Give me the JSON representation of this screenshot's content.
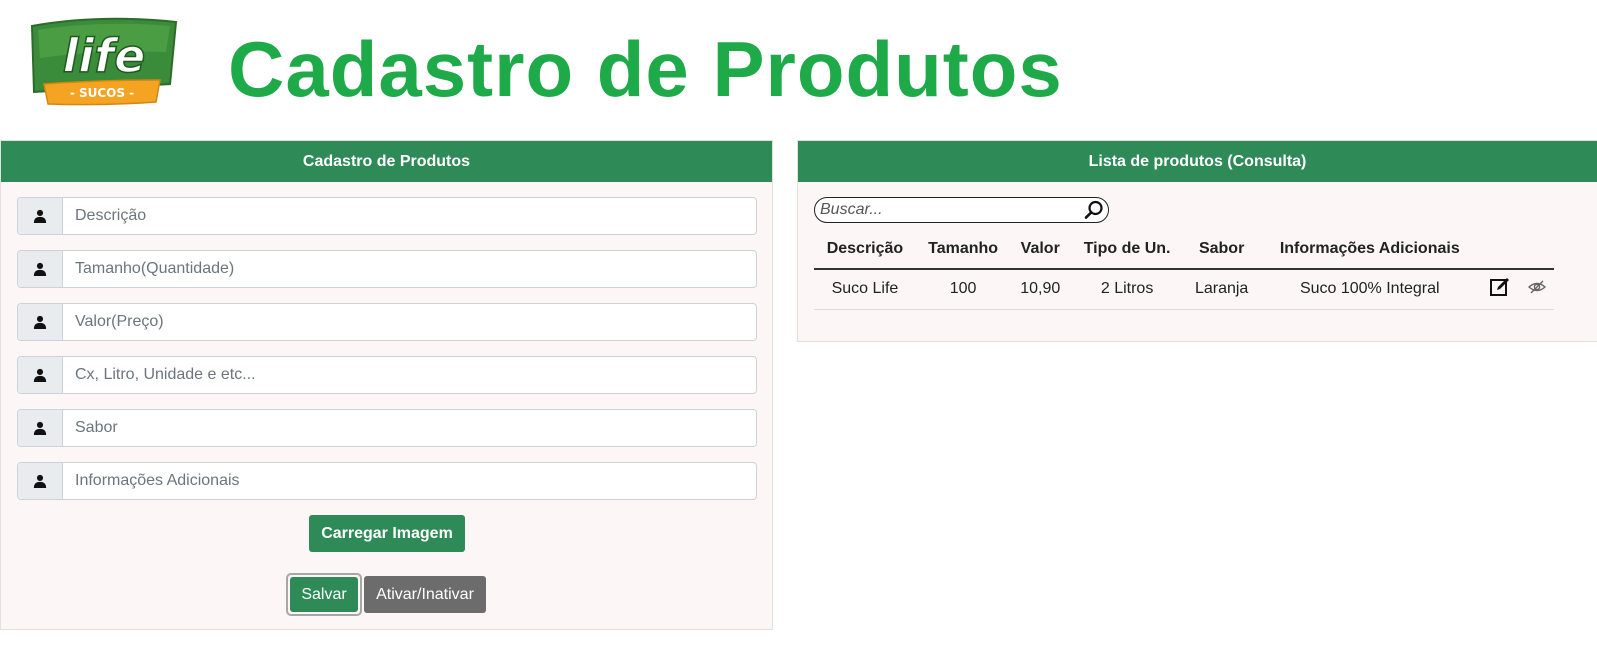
{
  "header": {
    "logo_text": "life",
    "logo_subtext": "SUCOS",
    "title": "Cadastro de Produtos"
  },
  "form": {
    "panel_title": "Cadastro de Produtos",
    "fields": [
      {
        "placeholder": "Descrição",
        "value": ""
      },
      {
        "placeholder": "Tamanho(Quantidade)",
        "value": ""
      },
      {
        "placeholder": "Valor(Preço)",
        "value": ""
      },
      {
        "placeholder": "Cx, Litro, Unidade e etc...",
        "value": ""
      },
      {
        "placeholder": "Sabor",
        "value": ""
      },
      {
        "placeholder": "Informações Adicionais",
        "value": ""
      }
    ],
    "field_icon": "user-icon",
    "load_image_label": "Carregar Imagem",
    "save_label": "Salvar",
    "toggle_label": "Ativar/Inativar"
  },
  "list": {
    "panel_title": "Lista de produtos (Consulta)",
    "search_placeholder": "Buscar...",
    "search_icon": "search-icon",
    "columns": [
      "Descrição",
      "Tamanho",
      "Valor",
      "Tipo de Un.",
      "Sabor",
      "Informações Adicionais"
    ],
    "rows": [
      {
        "descricao": "Suco Life",
        "tamanho": "100",
        "valor": "10,90",
        "tipo": "2 Litros",
        "sabor": "Laranja",
        "info": "Suco 100% Integral",
        "actions": [
          "edit-icon",
          "eye-off-icon"
        ]
      }
    ]
  },
  "colors": {
    "title_green": "#1faa4a",
    "header_green": "#2e8b57",
    "gray_button": "#6c6c6c",
    "logo_green": "#3b8c3a",
    "logo_orange": "#f5a323"
  }
}
